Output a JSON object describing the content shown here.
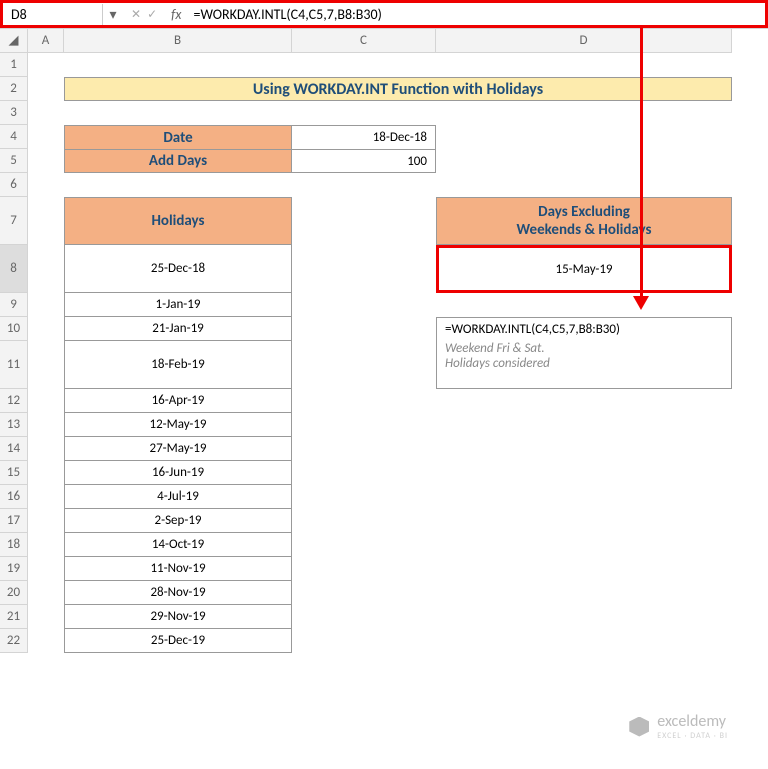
{
  "nameBox": "D8",
  "formula": "=WORKDAY.INTL(C4,C5,7,B8:B30)",
  "cols": [
    "",
    "A",
    "B",
    "C",
    "D"
  ],
  "rows": [
    "1",
    "2",
    "3",
    "4",
    "5",
    "6",
    "7",
    "8",
    "9",
    "10",
    "11",
    "12",
    "13",
    "14",
    "15",
    "16",
    "17",
    "18",
    "19",
    "20",
    "21",
    "22"
  ],
  "title": "Using WORKDAY.INT Function with Holidays",
  "labels": {
    "date": "Date",
    "addDays": "Add Days",
    "holidays": "Holidays",
    "resultHeader1": "Days Excluding",
    "resultHeader2": "Weekends & Holidays"
  },
  "values": {
    "date": "18-Dec-18",
    "addDays": "100",
    "result": "15-May-19"
  },
  "holidays": [
    "25-Dec-18",
    "1-Jan-19",
    "21-Jan-19",
    "18-Feb-19",
    "16-Apr-19",
    "12-May-19",
    "27-May-19",
    "16-Jun-19",
    "4-Jul-19",
    "2-Sep-19",
    "14-Oct-19",
    "11-Nov-19",
    "28-Nov-19",
    "29-Nov-19",
    "25-Dec-19"
  ],
  "noteFormula": "=WORKDAY.INTL(C4,C5,7,B8:B30)",
  "noteLine1": "Weekend Fri & Sat.",
  "noteLine2": "Holidays considered",
  "watermark": {
    "brand": "exceldemy",
    "tagline": "EXCEL · DATA · BI"
  }
}
